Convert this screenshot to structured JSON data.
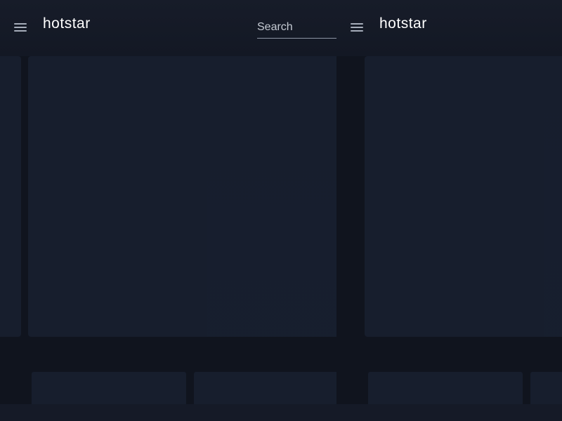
{
  "brand": {
    "name": "hotstar"
  },
  "search": {
    "placeholder": "Search"
  },
  "icons": {
    "menu": "hamburger-menu-icon"
  },
  "colors": {
    "background": "#10141e",
    "header": "#161b27",
    "card": "#171e2d",
    "text": "#ffffff"
  }
}
